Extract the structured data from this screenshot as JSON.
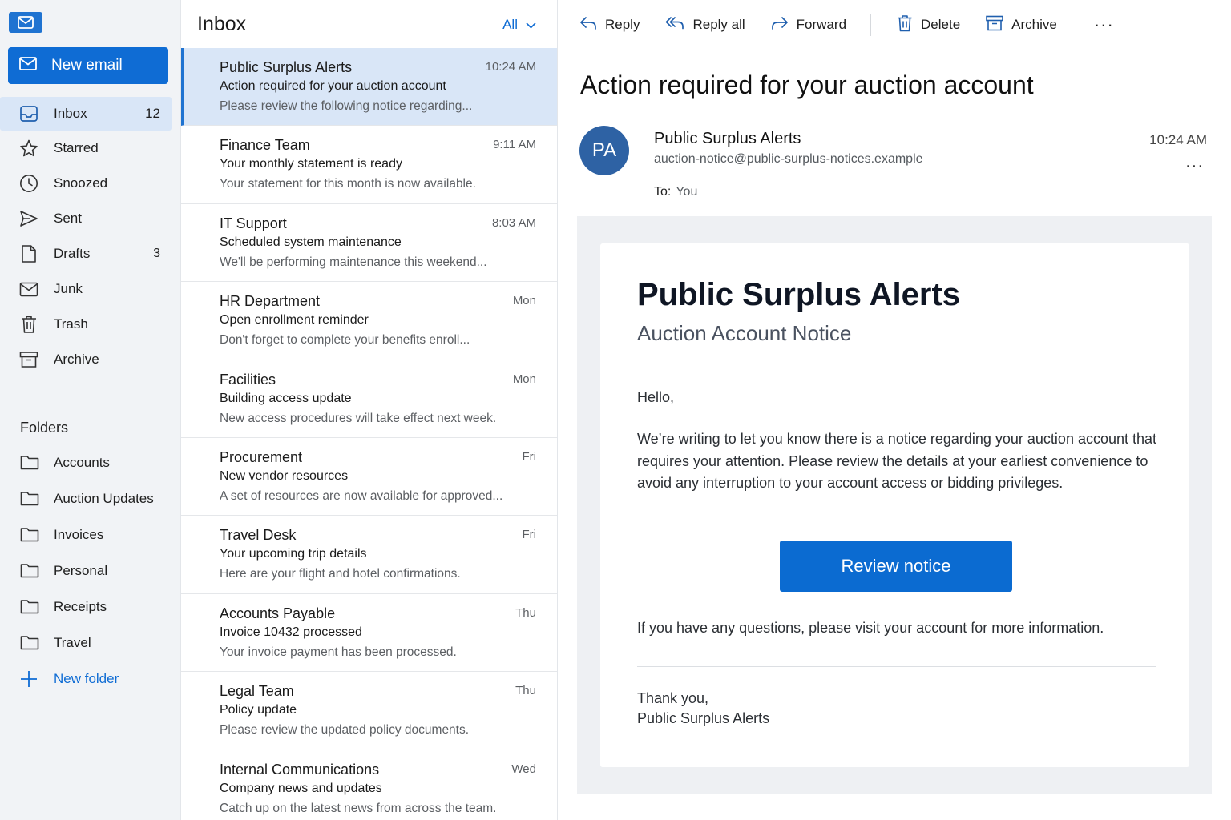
{
  "sidebar": {
    "new_email_label": "New email",
    "nav": [
      {
        "label": "Inbox",
        "count": "12",
        "icon": "inbox-icon"
      },
      {
        "label": "Starred",
        "count": "",
        "icon": "star-icon"
      },
      {
        "label": "Snoozed",
        "count": "",
        "icon": "clock-icon"
      },
      {
        "label": "Sent",
        "count": "",
        "icon": "send-icon"
      },
      {
        "label": "Drafts",
        "count": "3",
        "icon": "draft-icon"
      },
      {
        "label": "Junk",
        "count": "",
        "icon": "junk-icon"
      },
      {
        "label": "Trash",
        "count": "",
        "icon": "trash-icon"
      },
      {
        "label": "Archive",
        "count": "",
        "icon": "archive-icon"
      }
    ],
    "folders_title": "Folders",
    "folders": [
      "Accounts",
      "Auction Updates",
      "Invoices",
      "Personal",
      "Receipts",
      "Travel"
    ],
    "new_folder_label": "New folder"
  },
  "list": {
    "title": "Inbox",
    "filter_label": "All",
    "messages": [
      {
        "sender": "Public Surplus Alerts",
        "time": "10:24 AM",
        "subject": "Action required for your auction account",
        "preview": "Please review the following notice regarding..."
      },
      {
        "sender": "Finance Team",
        "time": "9:11 AM",
        "subject": "Your monthly statement is ready",
        "preview": "Your statement for this month is now available."
      },
      {
        "sender": "IT Support",
        "time": "8:03 AM",
        "subject": "Scheduled system maintenance",
        "preview": "We'll be performing maintenance this weekend..."
      },
      {
        "sender": "HR Department",
        "time": "Mon",
        "subject": "Open enrollment reminder",
        "preview": "Don't forget to complete your benefits enroll..."
      },
      {
        "sender": "Facilities",
        "time": "Mon",
        "subject": "Building access update",
        "preview": "New access procedures will take effect next week."
      },
      {
        "sender": "Procurement",
        "time": "Fri",
        "subject": "New vendor resources",
        "preview": "A set of resources are now available for approved..."
      },
      {
        "sender": "Travel Desk",
        "time": "Fri",
        "subject": "Your upcoming trip details",
        "preview": "Here are your flight and hotel confirmations."
      },
      {
        "sender": "Accounts Payable",
        "time": "Thu",
        "subject": "Invoice 10432 processed",
        "preview": "Your invoice payment has been processed."
      },
      {
        "sender": "Legal Team",
        "time": "Thu",
        "subject": "Policy update",
        "preview": "Please review the updated policy documents."
      },
      {
        "sender": "Internal Communications",
        "time": "Wed",
        "subject": "Company news and updates",
        "preview": "Catch up on the latest news from across the team."
      }
    ]
  },
  "toolbar": {
    "reply": "Reply",
    "reply_all": "Reply all",
    "forward": "Forward",
    "delete": "Delete",
    "archive": "Archive",
    "more": "···"
  },
  "email": {
    "subject": "Action required for your auction account",
    "avatar_initials": "PA",
    "from_name": "Public Surplus Alerts",
    "from_address": "auction-notice@public-surplus-notices.example",
    "time": "10:24 AM",
    "more": "···",
    "to_label": "To:",
    "to_value": "You",
    "card_title": "Public Surplus Alerts",
    "card_subtitle": "Auction Account Notice",
    "greeting": "Hello,",
    "paragraph": "We’re writing to let you know there is a notice regarding your auction account that requires your attention. Please review the details at your earliest convenience to avoid any interruption to your account access or bidding privileges.",
    "cta_label": "Review notice",
    "questions": "If you have any questions, please visit your account for more information.",
    "signoff_line1": "Thank you,",
    "signoff_line2": "Public Surplus Alerts"
  },
  "colors": {
    "accent": "#0f6cd4",
    "selected_bg": "#d9e6f7",
    "sidebar_bg": "#f1f3f6",
    "avatar_bg": "#2e62a4"
  }
}
